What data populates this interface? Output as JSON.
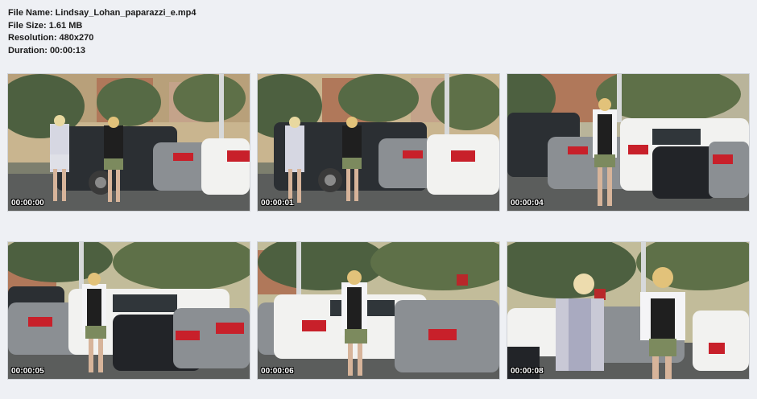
{
  "file_info": {
    "file_name": "File Name: Lindsay_Lohan_paparazzi_e.mp4",
    "file_size": "File Size: 1.61 MB",
    "resolution": "Resolution: 480x270",
    "duration": "Duration: 00:00:13"
  },
  "thumbnails": [
    {
      "timestamp": "00:00:00"
    },
    {
      "timestamp": "00:00:01"
    },
    {
      "timestamp": "00:00:04"
    },
    {
      "timestamp": "00:00:05"
    },
    {
      "timestamp": "00:00:06"
    },
    {
      "timestamp": "00:00:08"
    }
  ],
  "colors": {
    "background": "#eef0f4",
    "sky": "#c9b58f",
    "trees": "#4d6040",
    "asphalt": "#5b5d5c",
    "car_white": "#f2f2f0",
    "car_silver": "#8b8f93",
    "car_dark": "#2b2f33",
    "tail_light": "#c8202a"
  }
}
